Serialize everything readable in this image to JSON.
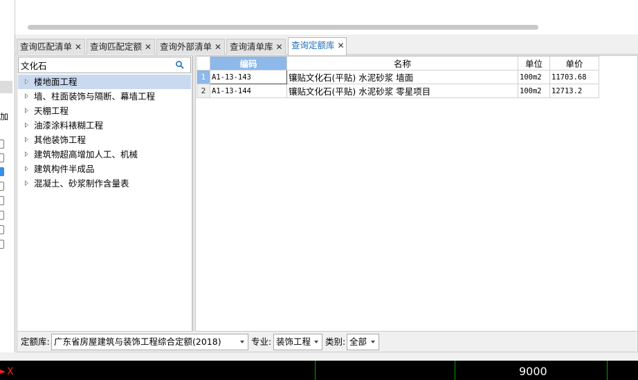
{
  "tabs": [
    {
      "label": "查询匹配清单",
      "close": "✕",
      "active": false
    },
    {
      "label": "查询匹配定额",
      "close": "✕",
      "active": false
    },
    {
      "label": "查询外部清单",
      "close": "✕",
      "active": false
    },
    {
      "label": "查询清单库",
      "close": "✕",
      "active": false
    },
    {
      "label": "查询定额库",
      "close": "✕",
      "active": true
    }
  ],
  "left_strip": {
    "header_glyph": "加"
  },
  "search": {
    "value": "文化石",
    "icon": "search-icon"
  },
  "tree": {
    "items": [
      {
        "label": "楼地面工程",
        "selected": true
      },
      {
        "label": "墙、柱面装饰与隔断、幕墙工程",
        "selected": false
      },
      {
        "label": "天棚工程",
        "selected": false
      },
      {
        "label": "油漆涂料裱糊工程",
        "selected": false
      },
      {
        "label": "其他装饰工程",
        "selected": false
      },
      {
        "label": "建筑物超高增加人工、机械",
        "selected": false
      },
      {
        "label": "建筑构件半成品",
        "selected": false
      },
      {
        "label": "混凝土、砂浆制作含量表",
        "selected": false
      }
    ]
  },
  "grid": {
    "headers": {
      "code": "编码",
      "name": "名称",
      "unit": "单位",
      "price": "单价"
    },
    "rows": [
      {
        "num": "1",
        "code": "A1-13-143",
        "name": "镶贴文化石(平贴) 水泥砂浆 墙面",
        "unit": "100m2",
        "price": "11703.68"
      },
      {
        "num": "2",
        "code": "A1-13-144",
        "name": "镶贴文化石(平贴) 水泥砂浆 零星项目",
        "unit": "100m2",
        "price": "12713.2"
      }
    ]
  },
  "filters": {
    "library_label": "定额库:",
    "library_value": "广东省房屋建筑与装饰工程综合定额(2018)",
    "specialty_label": "专业:",
    "specialty_value": "装饰工程",
    "category_label": "类别:",
    "category_value": "全部"
  },
  "status": {
    "value": "9000",
    "axis_label": "X"
  },
  "colors": {
    "accent": "#1e6fb8",
    "header_highlight": "#8db8ea",
    "selection": "#c9daf0",
    "status_divider": "#00a000"
  }
}
